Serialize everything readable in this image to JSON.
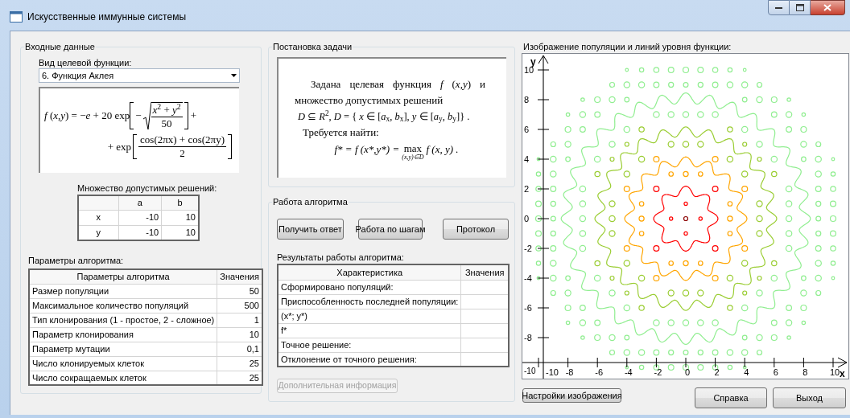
{
  "window": {
    "title": "Искусственные иммунные системы"
  },
  "input_group": {
    "title": "Входные данные",
    "function_label": "Вид целевой функции:",
    "function_select": {
      "value": "6. Функция Аклея"
    },
    "formula": {
      "lhs": "*f* (*x*,*y*) = −*e* + 20 exp",
      "minus": "−",
      "sqrt_num": "*x*$^{2}$ + *y*$^{2}$",
      "sqrt_den": "50",
      "tail": "+",
      "lead": "+ exp",
      "frac_num": "cos(2πx) + cos(2πy)",
      "frac_den": "2"
    },
    "domain": {
      "title": "Множество допустимых решений:",
      "columns": [
        "a",
        "b"
      ],
      "rows": [
        {
          "name": "x",
          "cells": [
            "-10",
            "10"
          ]
        },
        {
          "name": "y",
          "cells": [
            "-10",
            "10"
          ]
        }
      ]
    },
    "params": {
      "title": "Параметры алгоритма:",
      "columns": [
        "Параметры алгоритма",
        "Значения"
      ],
      "rows": [
        [
          "Размер популяции",
          "50"
        ],
        [
          "Максимальное количество популяций",
          "500"
        ],
        [
          "Тип клонирования (1 - простое, 2 - сложное)",
          "1"
        ],
        [
          "Параметр клонирования",
          "10"
        ],
        [
          "Параметр мутации",
          "0,1"
        ],
        [
          "Число клонируемых клеток",
          "25"
        ],
        [
          "Число сокращаемых клеток",
          "25"
        ]
      ]
    }
  },
  "problem": {
    "title": "Постановка задачи",
    "lines": [
      "Задана целевая функция *f* (*x*,*y*) и",
      "множество допустимых решений",
      "*D* ⊆ *R*$^{2}$, *D* = { *x* ∈ [*a*$_{x}$, *b*$_{x}$], *y* ∈ [*a*$_{y}$, *b*$_{y}$]} .",
      "Требуется найти:"
    ],
    "target": {
      "lhs": "f* = f (x*,y*) =",
      "operator": "max",
      "subscript": "(x,y)∈D",
      "rhs": "f (x, y) ."
    }
  },
  "algorithm": {
    "title": "Работа алгоритма",
    "buttons": [
      {
        "label": "Получить ответ"
      },
      {
        "label": "Работа по шагам"
      },
      {
        "label": "Протокол"
      }
    ],
    "results": {
      "title": "Результаты работы алгоритма:",
      "columns": [
        "Характеристика",
        "Значения"
      ],
      "rows": [
        "Сформировано популяций:",
        "Приспособленность последней популяции:",
        "(x*; y*)",
        "f*",
        "Точное решение:",
        "Отклонение от точного решения:"
      ]
    },
    "extra_button": {
      "label": "Дополнительная информация",
      "disabled": true
    }
  },
  "plot": {
    "title": "Изображение популяции и линий уровня функции:",
    "y_axis_label": "y",
    "x_axis_label": "x",
    "y_ticks": [
      "10",
      "8",
      "6",
      "4",
      "2",
      "0",
      "-2",
      "-4",
      "-6",
      "-8",
      "-10"
    ],
    "x_ticks": [
      "-10",
      "-8",
      "-6",
      "-4",
      "-2",
      "0",
      "2",
      "4",
      "6",
      "8",
      "10"
    ],
    "settings_button": "Настройки изображения"
  },
  "buttons": [
    "Справка",
    "Выход"
  ]
}
